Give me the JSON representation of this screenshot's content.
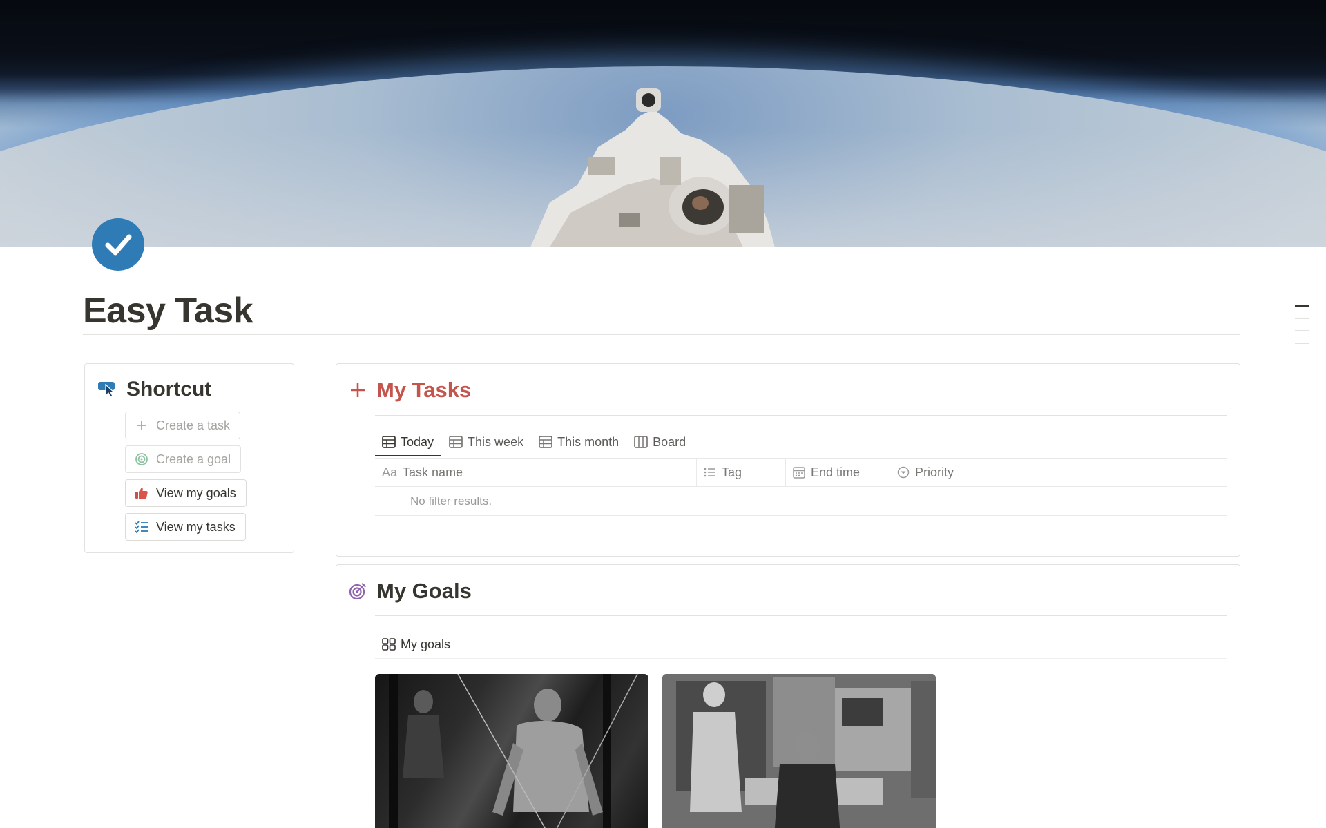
{
  "page": {
    "title": "Easy Task",
    "colors": {
      "accent_red": "#c4554d",
      "icon_blue": "#2e7bb5",
      "goal_purple": "#9065b0",
      "text": "#37352f",
      "muted": "#a6a5a1"
    }
  },
  "shortcut": {
    "label": "Shortcut",
    "icon": "pointer-click-icon",
    "buttons": [
      {
        "label": "Create a task",
        "icon": "plus-icon",
        "style": "dim"
      },
      {
        "label": "Create a goal",
        "icon": "target-icon",
        "style": "dim"
      },
      {
        "label": "View my goals",
        "icon": "thumbs-up-icon",
        "style": "dark"
      },
      {
        "label": "View my tasks",
        "icon": "checklist-icon",
        "style": "dark"
      }
    ]
  },
  "tasks": {
    "label": "My Tasks",
    "icon": "plus-icon",
    "views": [
      {
        "label": "Today",
        "icon": "table-icon",
        "active": true
      },
      {
        "label": "This week",
        "icon": "table-icon",
        "active": false
      },
      {
        "label": "This month",
        "icon": "table-icon",
        "active": false
      },
      {
        "label": "Board",
        "icon": "board-icon",
        "active": false
      }
    ],
    "columns": [
      {
        "label": "Task name",
        "icon": "text-aa-icon",
        "glyph": "Aa"
      },
      {
        "label": "Tag",
        "icon": "list-icon"
      },
      {
        "label": "End time",
        "icon": "calendar-icon"
      },
      {
        "label": "Priority",
        "icon": "select-icon"
      }
    ],
    "empty_text": "No filter results."
  },
  "goals": {
    "label": "My Goals",
    "icon": "target-icon",
    "view_label": "My goals",
    "view_icon": "gallery-icon",
    "cards": [
      {
        "image": "gym-photo"
      },
      {
        "image": "computer-room-photo"
      }
    ]
  }
}
